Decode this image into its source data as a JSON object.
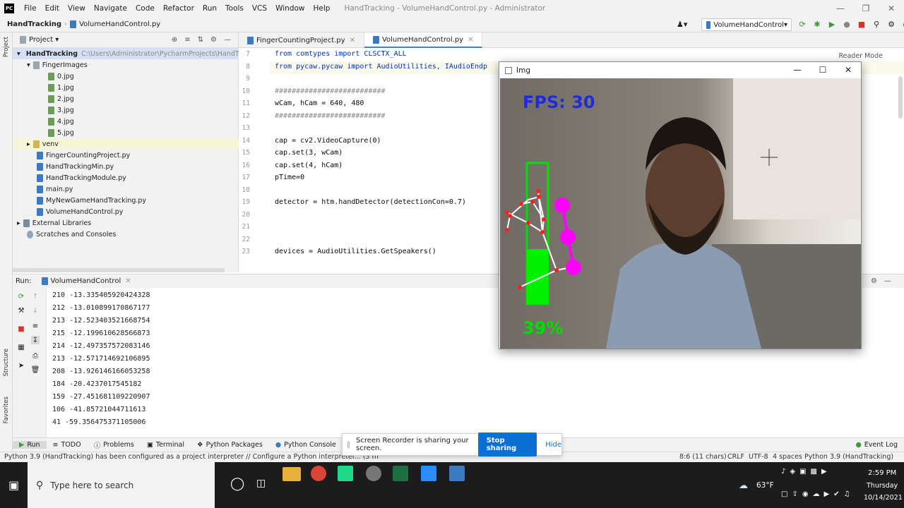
{
  "app": {
    "logo": "PC",
    "menu": [
      "File",
      "Edit",
      "View",
      "Navigate",
      "Code",
      "Refactor",
      "Run",
      "Tools",
      "VCS",
      "Window",
      "Help"
    ],
    "window_title": "HandTracking - VolumeHandControl.py - Administrator"
  },
  "nav": {
    "project": "HandTracking",
    "file": "VolumeHandControl.py",
    "run_config": "VolumeHandControl"
  },
  "project_panel": {
    "title": "Project",
    "root_name": "HandTracking",
    "root_path": "C:\\Users\\Administrator\\PycharmProjects\\HandTrack",
    "items": [
      {
        "label": "FingerImages",
        "kind": "folder"
      },
      {
        "label": "0.jpg",
        "kind": "img"
      },
      {
        "label": "1.jpg",
        "kind": "img"
      },
      {
        "label": "2.jpg",
        "kind": "img"
      },
      {
        "label": "3.jpg",
        "kind": "img"
      },
      {
        "label": "4.jpg",
        "kind": "img"
      },
      {
        "label": "5.jpg",
        "kind": "img"
      },
      {
        "label": "venv",
        "kind": "folder"
      },
      {
        "label": "FingerCountingProject.py",
        "kind": "py"
      },
      {
        "label": "HandTrackingMin.py",
        "kind": "py"
      },
      {
        "label": "HandTrackingModule.py",
        "kind": "py"
      },
      {
        "label": "main.py",
        "kind": "py"
      },
      {
        "label": "MyNewGameHandTracking.py",
        "kind": "py"
      },
      {
        "label": "VolumeHandControl.py",
        "kind": "py"
      },
      {
        "label": "External Libraries",
        "kind": "lib"
      },
      {
        "label": "Scratches and Consoles",
        "kind": "lib"
      }
    ]
  },
  "tabs": [
    "FingerCountingProject.py",
    "VolumeHandControl.py"
  ],
  "reader_mode": "Reader Mode",
  "editor": {
    "line_numbers": [
      "7",
      "8",
      "9",
      "10",
      "11",
      "12",
      "13",
      "14",
      "15",
      "16",
      "17",
      "18",
      "19",
      "20",
      "21",
      "22",
      "23"
    ],
    "lines": [
      "from comtypes import CLSCTX_ALL",
      "from pycaw.pycaw import AudioUtilities, IAudioEndp",
      "",
      "##########################",
      "wCam, hCam = 640, 480",
      "##########################",
      "",
      "cap = cv2.VideoCapture(0)",
      "cap.set(3, wCam)",
      "cap.set(4, hCam)",
      "pTime=0",
      "",
      "detector = htm.handDetector(detectionCon=0.7)",
      "",
      "",
      "",
      "devices = AudioUtilities.GetSpeakers()"
    ]
  },
  "run": {
    "label": "Run:",
    "config": "VolumeHandControl",
    "output": [
      "210 -13.335405920424328",
      "212 -13.010899170867177",
      "213 -12.523403521668754",
      "215 -12.199610628566873",
      "214 -12.497357572083146",
      "213 -12.571714692106895",
      "208 -13.926146166053258",
      "184 -20.4237017545182",
      "159 -27.451681109220907",
      "106 -41.85721044711613",
      "41 -59.356475371105006"
    ]
  },
  "side_labels": {
    "project": "Project",
    "structure": "Structure",
    "favorites": "Favorites"
  },
  "bottom_tabs": [
    "Run",
    "TODO",
    "Problems",
    "Terminal",
    "Python Packages",
    "Python Console"
  ],
  "event_log": "Event Log",
  "status": {
    "message": "Python 3.9 (HandTracking) has been configured as a project interpreter // Configure a Python interpreter... (3 minutes ago)",
    "position": "8:6 (11 chars)",
    "line_sep": "CRLF",
    "encoding": "UTF-8",
    "indent": "4 spaces",
    "interpreter": "Python 3.9 (HandTracking)"
  },
  "img_window": {
    "title": "Img",
    "fps": "FPS: 30",
    "volume": "39%",
    "volume_level": 0.39
  },
  "share": {
    "message": "Screen Recorder is sharing your screen.",
    "stop": "Stop sharing",
    "hide": "Hide"
  },
  "taskbar": {
    "search_placeholder": "Type here to search",
    "temp": "63°F",
    "time": "2:59 PM",
    "day": "Thursday",
    "date": "10/14/2021"
  }
}
